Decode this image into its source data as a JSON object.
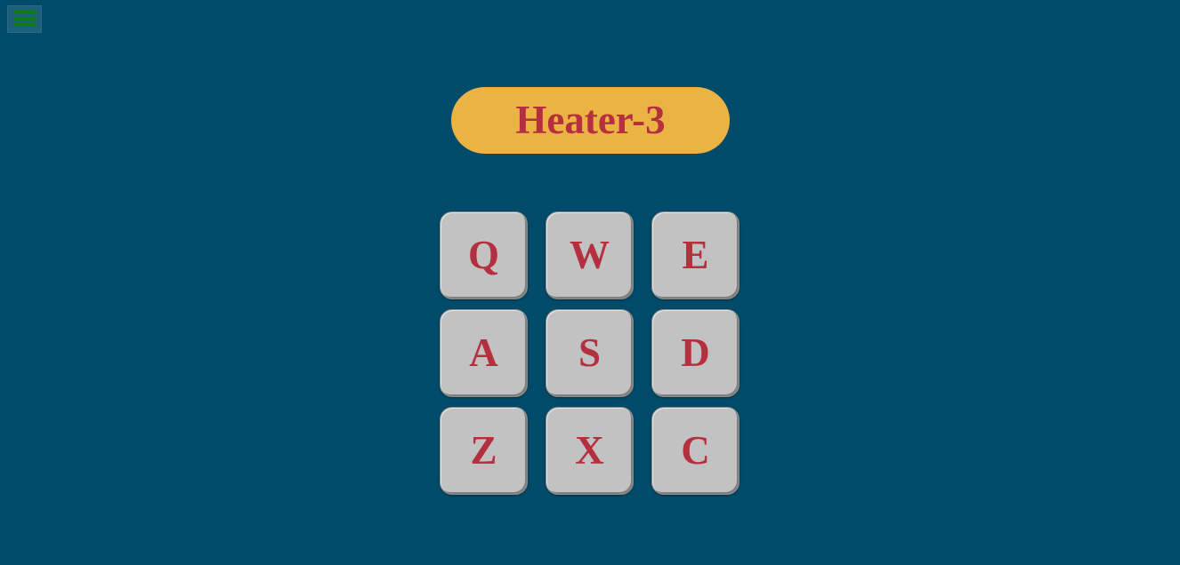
{
  "app": {
    "title": "Heater-3"
  },
  "colors": {
    "background": "#004b69",
    "title_pill": "#ebb343",
    "accent_text": "#b5303f",
    "pad": "#c2c2c2",
    "menu_icon": "#0e7a1c"
  },
  "menu": {
    "icon": "hamburger-menu-icon"
  },
  "pads": [
    {
      "key": "Q"
    },
    {
      "key": "W"
    },
    {
      "key": "E"
    },
    {
      "key": "A"
    },
    {
      "key": "S"
    },
    {
      "key": "D"
    },
    {
      "key": "Z"
    },
    {
      "key": "X"
    },
    {
      "key": "C"
    }
  ]
}
